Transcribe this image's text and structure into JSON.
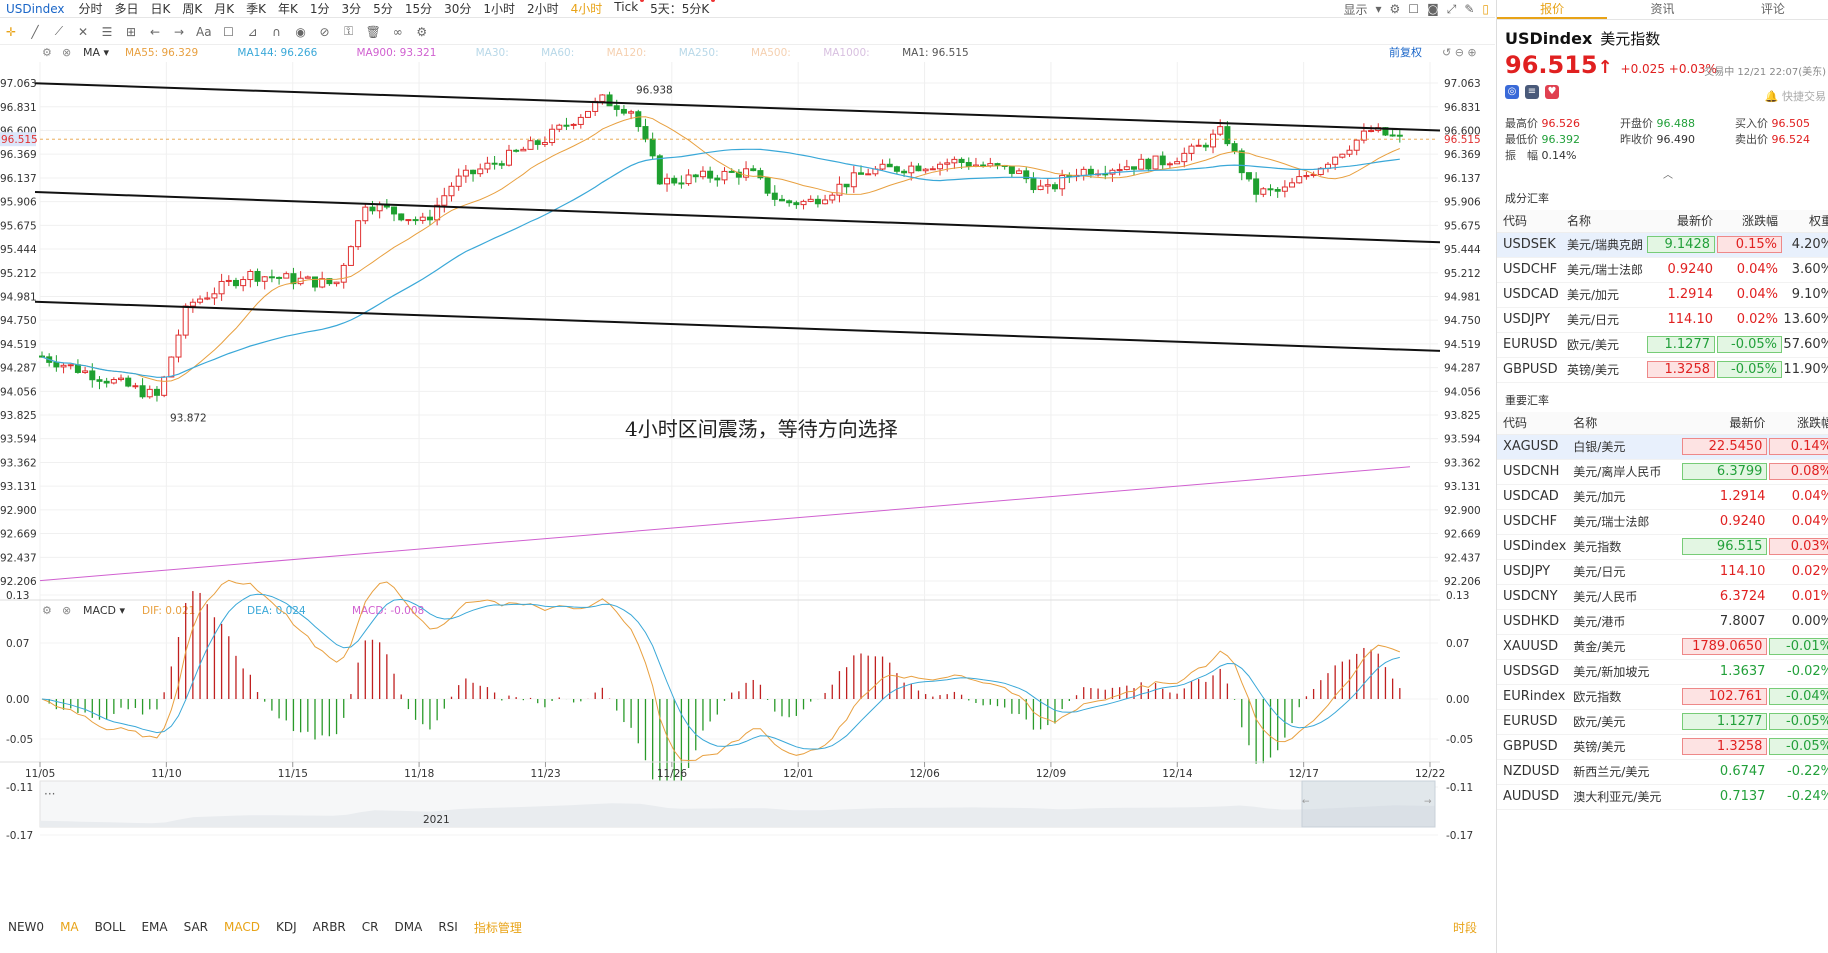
{
  "toolbar": {
    "symbol": "USDindex",
    "periods": [
      "分时",
      "多日",
      "日K",
      "周K",
      "月K",
      "季K",
      "年K",
      "1分",
      "3分",
      "5分",
      "15分",
      "30分",
      "1小时",
      "2小时",
      "4小时",
      "Tick",
      "5天：5分K"
    ],
    "active_period": "4小时",
    "display_label": "显示"
  },
  "ma_legend": {
    "title": "MA",
    "items": [
      {
        "label": "MA55: 96.329",
        "color": "#e8a040"
      },
      {
        "label": "MA144: 96.266",
        "color": "#3aa8d8"
      },
      {
        "label": "MA900: 93.321",
        "color": "#d060d0"
      },
      {
        "label": "MA30:",
        "color": "#b8d8e8"
      },
      {
        "label": "MA60:",
        "color": "#b8d8e8"
      },
      {
        "label": "MA120:",
        "color": "#f5d0b0"
      },
      {
        "label": "MA250:",
        "color": "#b8d8e8"
      },
      {
        "label": "MA500:",
        "color": "#f5d0b0"
      },
      {
        "label": "MA1000:",
        "color": "#d8c0e0"
      },
      {
        "label": "MA1: 96.515",
        "color": "#555555"
      }
    ],
    "adjust": "前复权"
  },
  "macd_legend": {
    "title": "MACD",
    "items": [
      {
        "label": "DIF: 0.021",
        "color": "#e8a040"
      },
      {
        "label": "DEA: 0.024",
        "color": "#3aa8d8"
      },
      {
        "label": "MACD: -0.008",
        "color": "#d060d0"
      }
    ]
  },
  "chart": {
    "annotation": "4小时区间震荡，等待方向选择",
    "high_label": "96.938",
    "low_label": "93.872",
    "price_ticks": [
      "97.063",
      "96.831",
      "96.600",
      "96.369",
      "96.137",
      "95.906",
      "95.675",
      "95.444",
      "95.212",
      "94.981",
      "94.750",
      "94.519",
      "94.287",
      "94.056",
      "93.825",
      "93.594",
      "93.362",
      "93.131",
      "92.900",
      "92.669",
      "92.437",
      "92.206"
    ],
    "last_price": "96.515",
    "macd_ticks": [
      "0.13",
      "0.07",
      "0.00",
      "-0.05",
      "-0.11",
      "-0.17"
    ],
    "dates": [
      "11/05",
      "11/10",
      "11/15",
      "11/18",
      "11/23",
      "11/26",
      "12/01",
      "12/06",
      "12/09",
      "12/14",
      "12/17",
      "12/22"
    ],
    "year_label": "2021"
  },
  "chart_data": {
    "type": "candlestick",
    "title": "",
    "ylim": [
      92.206,
      97.063
    ],
    "channel_lines": [
      {
        "from": [
          "11/05",
          97.06
        ],
        "to": [
          "12/22",
          96.6
        ]
      },
      {
        "from": [
          "11/05",
          96.0
        ],
        "to": [
          "12/22",
          95.51
        ]
      },
      {
        "from": [
          "11/05",
          94.93
        ],
        "to": [
          "12/22",
          94.45
        ]
      }
    ],
    "series_close_approx": [
      {
        "date": "11/05",
        "value": 94.4
      },
      {
        "date": "11/08",
        "value": 94.1
      },
      {
        "date": "11/09",
        "value": 94.0
      },
      {
        "date": "11/10",
        "value": 94.9
      },
      {
        "date": "11/12",
        "value": 95.2
      },
      {
        "date": "11/15",
        "value": 95.1
      },
      {
        "date": "11/16",
        "value": 95.9
      },
      {
        "date": "11/18",
        "value": 95.7
      },
      {
        "date": "11/19",
        "value": 96.1
      },
      {
        "date": "11/22",
        "value": 96.5
      },
      {
        "date": "11/24",
        "value": 96.9
      },
      {
        "date": "11/25",
        "value": 96.8
      },
      {
        "date": "11/26",
        "value": 96.1
      },
      {
        "date": "11/29",
        "value": 96.2
      },
      {
        "date": "11/30",
        "value": 95.9
      },
      {
        "date": "12/01",
        "value": 95.9
      },
      {
        "date": "12/03",
        "value": 96.2
      },
      {
        "date": "12/06",
        "value": 96.3
      },
      {
        "date": "12/08",
        "value": 96.2
      },
      {
        "date": "12/09",
        "value": 96.0
      },
      {
        "date": "12/10",
        "value": 96.2
      },
      {
        "date": "12/13",
        "value": 96.3
      },
      {
        "date": "12/14",
        "value": 96.4
      },
      {
        "date": "12/15",
        "value": 96.6
      },
      {
        "date": "12/16",
        "value": 96.0
      },
      {
        "date": "12/17",
        "value": 96.0
      },
      {
        "date": "12/20",
        "value": 96.6
      },
      {
        "date": "12/21",
        "value": 96.515
      }
    ]
  },
  "tabs": [
    "报价",
    "资讯",
    "评论"
  ],
  "quote": {
    "symbol": "USDindex",
    "name": "美元指数",
    "price": "96.515",
    "arrow": "↑",
    "change": "+0.025 +0.03%",
    "trade_time": "交易中 12/21 22:07(美东)",
    "quick": "快捷交易",
    "stats": [
      [
        {
          "l": "最高价",
          "v": "96.526",
          "c": "up"
        },
        {
          "l": "开盘价",
          "v": "96.488",
          "c": "dn"
        },
        {
          "l": "买入价",
          "v": "96.505",
          "c": "up"
        }
      ],
      [
        {
          "l": "最低价",
          "v": "96.392",
          "c": "dn"
        },
        {
          "l": "昨收价",
          "v": "96.490",
          "c": ""
        },
        {
          "l": "卖出价",
          "v": "96.524",
          "c": "up"
        }
      ],
      [
        {
          "l": "振　幅",
          "v": "0.14%",
          "c": ""
        }
      ]
    ]
  },
  "composite": {
    "title": "成分汇率",
    "headers": [
      "代码",
      "名称",
      "最新价",
      "涨跌幅",
      "权重"
    ],
    "rows": [
      {
        "code": "USDSEK",
        "name": "美元/瑞典克朗",
        "price": "9.1428",
        "chg": "0.15%",
        "w": "4.20%",
        "dir": "up",
        "box": "dn",
        "sel": true
      },
      {
        "code": "USDCHF",
        "name": "美元/瑞士法郎",
        "price": "0.9240",
        "chg": "0.04%",
        "w": "3.60%",
        "dir": "up",
        "box": ""
      },
      {
        "code": "USDCAD",
        "name": "美元/加元",
        "price": "1.2914",
        "chg": "0.04%",
        "w": "9.10%",
        "dir": "up",
        "box": ""
      },
      {
        "code": "USDJPY",
        "name": "美元/日元",
        "price": "114.10",
        "chg": "0.02%",
        "w": "13.60%",
        "dir": "up",
        "box": ""
      },
      {
        "code": "EURUSD",
        "name": "欧元/美元",
        "price": "1.1277",
        "chg": "-0.05%",
        "w": "57.60%",
        "dir": "dn",
        "box": "dn"
      },
      {
        "code": "GBPUSD",
        "name": "英镑/美元",
        "price": "1.3258",
        "chg": "-0.05%",
        "w": "11.90%",
        "dir": "dn",
        "box": "up"
      }
    ]
  },
  "major": {
    "title": "重要汇率",
    "headers": [
      "代码",
      "名称",
      "最新价",
      "涨跌幅"
    ],
    "rows": [
      {
        "code": "XAGUSD",
        "name": "白银/美元",
        "price": "22.5450",
        "chg": "0.14%",
        "dir": "up",
        "box": "up",
        "sel": true
      },
      {
        "code": "USDCNH",
        "name": "美元/离岸人民币",
        "price": "6.3799",
        "chg": "0.08%",
        "dir": "up",
        "box": "dn"
      },
      {
        "code": "USDCAD",
        "name": "美元/加元",
        "price": "1.2914",
        "chg": "0.04%",
        "dir": "up",
        "box": ""
      },
      {
        "code": "USDCHF",
        "name": "美元/瑞士法郎",
        "price": "0.9240",
        "chg": "0.04%",
        "dir": "up",
        "box": ""
      },
      {
        "code": "USDindex",
        "name": "美元指数",
        "price": "96.515",
        "chg": "0.03%",
        "dir": "up",
        "box": "dn"
      },
      {
        "code": "USDJPY",
        "name": "美元/日元",
        "price": "114.10",
        "chg": "0.02%",
        "dir": "up",
        "box": ""
      },
      {
        "code": "USDCNY",
        "name": "美元/人民币",
        "price": "6.3724",
        "chg": "0.01%",
        "dir": "up",
        "box": ""
      },
      {
        "code": "USDHKD",
        "name": "美元/港币",
        "price": "7.8007",
        "chg": "0.00%",
        "dir": "",
        "box": ""
      },
      {
        "code": "XAUUSD",
        "name": "黄金/美元",
        "price": "1789.0650",
        "chg": "-0.01%",
        "dir": "dn",
        "box": "up"
      },
      {
        "code": "USDSGD",
        "name": "美元/新加坡元",
        "price": "1.3637",
        "chg": "-0.02%",
        "dir": "dn",
        "box": ""
      },
      {
        "code": "EURindex",
        "name": "欧元指数",
        "price": "102.761",
        "chg": "-0.04%",
        "dir": "dn",
        "box": "up"
      },
      {
        "code": "EURUSD",
        "name": "欧元/美元",
        "price": "1.1277",
        "chg": "-0.05%",
        "dir": "dn",
        "box": "dn"
      },
      {
        "code": "GBPUSD",
        "name": "英镑/美元",
        "price": "1.3258",
        "chg": "-0.05%",
        "dir": "dn",
        "box": "up"
      },
      {
        "code": "NZDUSD",
        "name": "新西兰元/美元",
        "price": "0.6747",
        "chg": "-0.22%",
        "dir": "dn",
        "box": ""
      },
      {
        "code": "AUDUSD",
        "name": "澳大利亚元/美元",
        "price": "0.7137",
        "chg": "-0.24%",
        "dir": "dn",
        "box": ""
      }
    ]
  },
  "indicators": [
    "NEW0",
    "MA",
    "BOLL",
    "EMA",
    "SAR",
    "MACD",
    "KDJ",
    "ARBR",
    "CR",
    "DMA",
    "RSI"
  ],
  "indicators_on": [
    "MA",
    "MACD"
  ],
  "indicator_manager": "指标管理",
  "time_label": "时段"
}
